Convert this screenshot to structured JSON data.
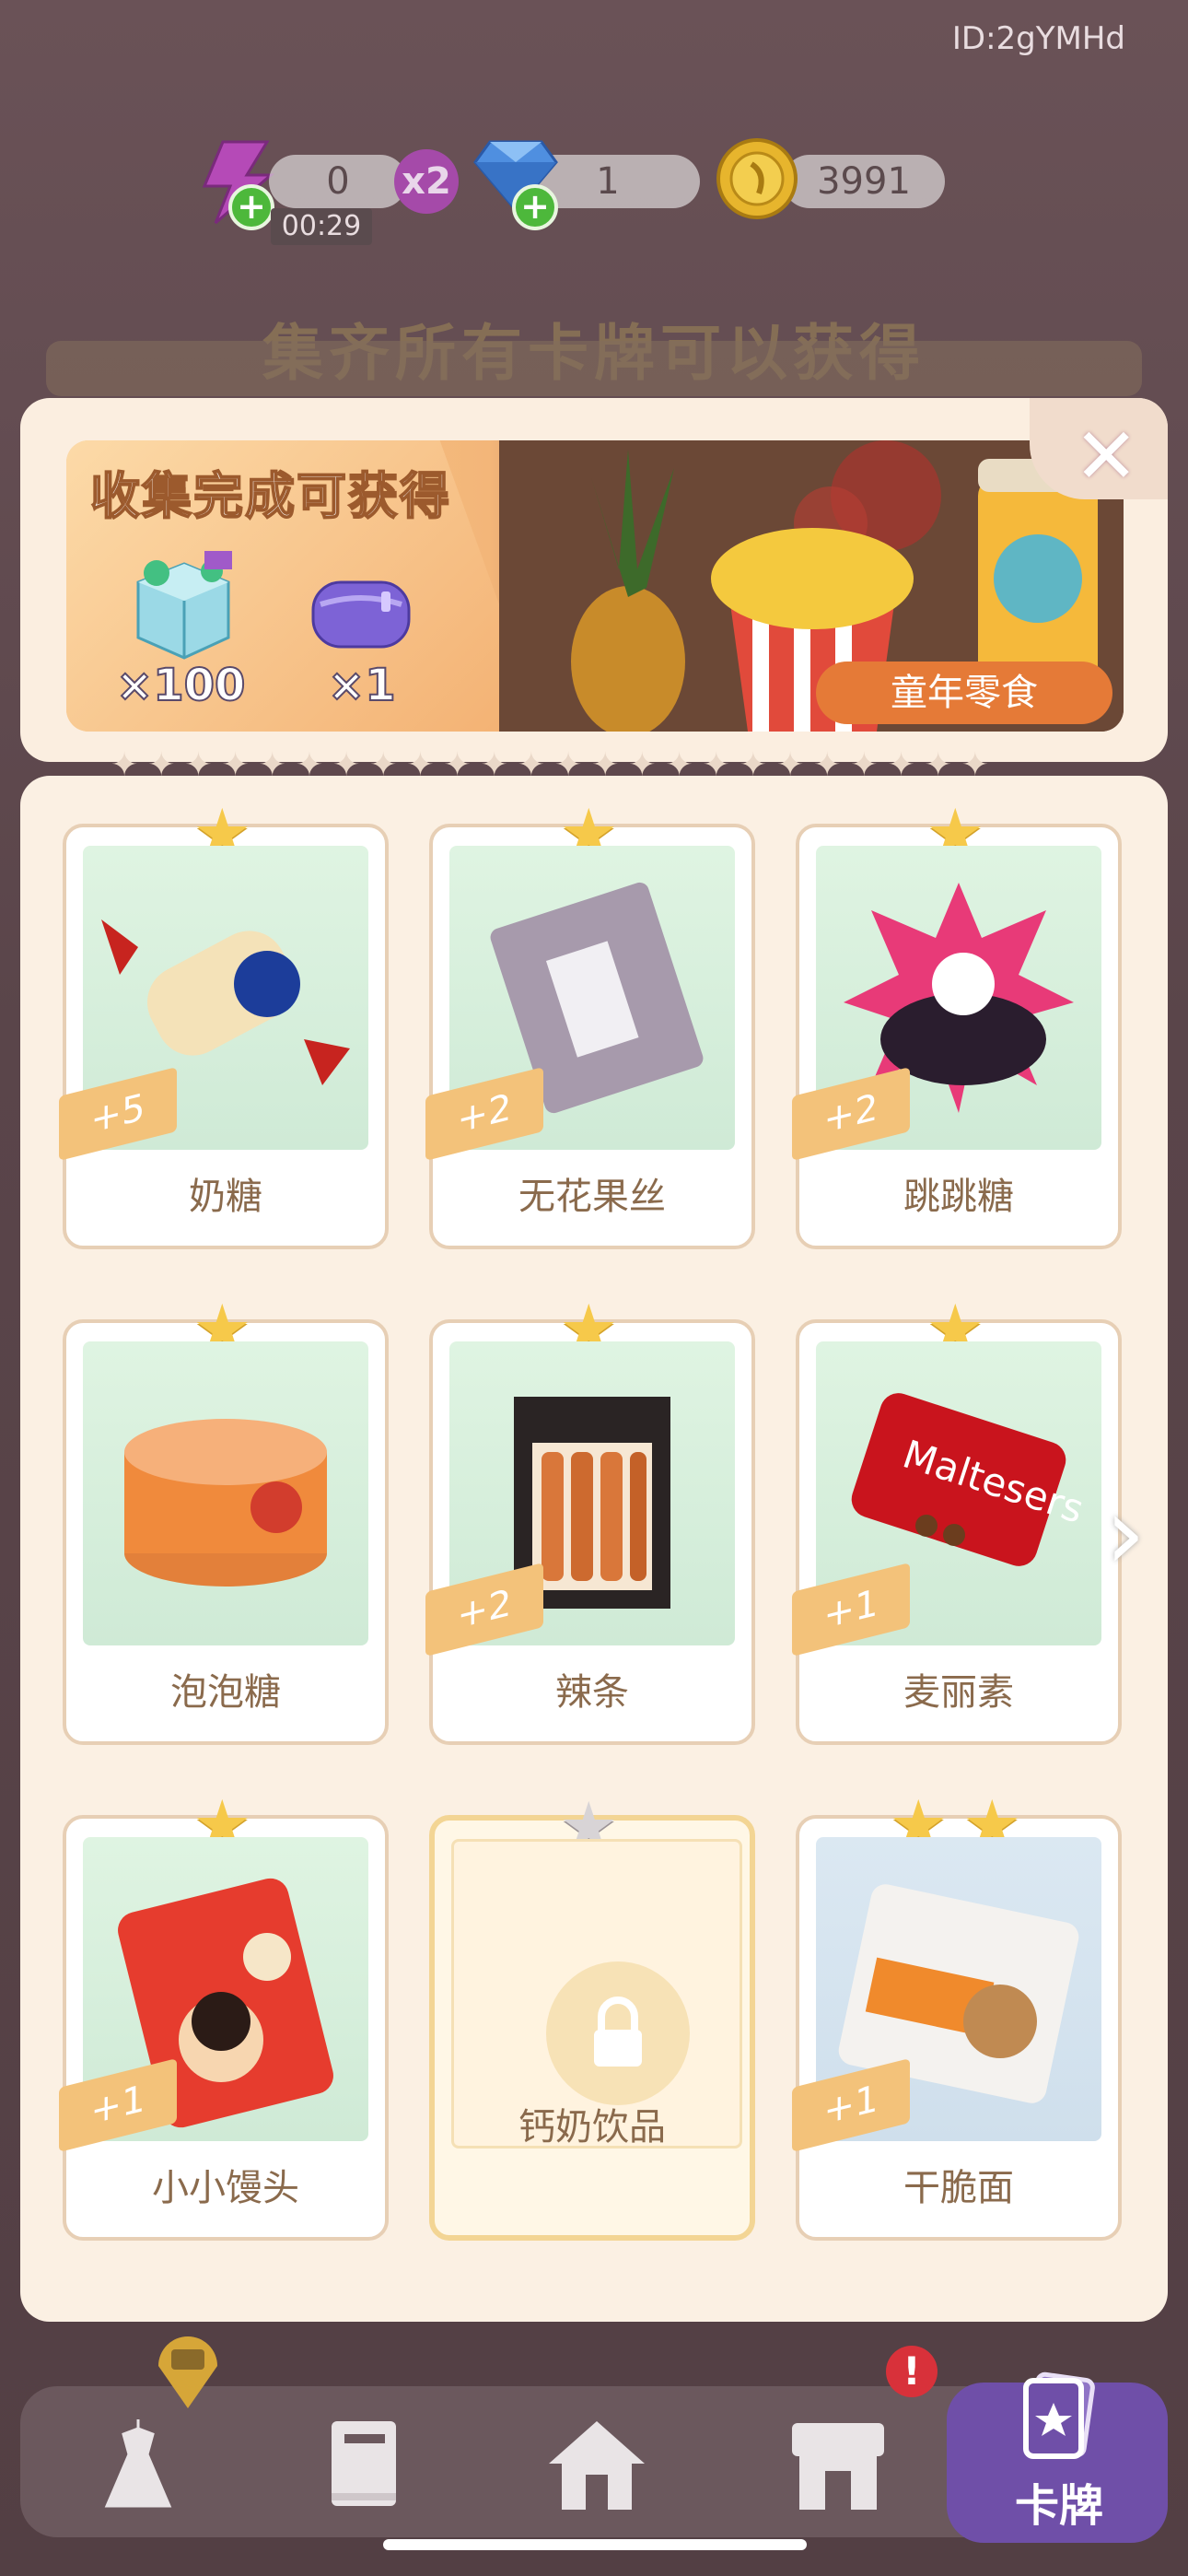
{
  "status": {
    "user_id": "ID:2gYMHd"
  },
  "resources": {
    "energy": {
      "value": "0",
      "multiplier": "x2",
      "timer": "00:29"
    },
    "gems": {
      "value": "1"
    },
    "coins": {
      "value": "3991"
    }
  },
  "background": {
    "title": "集齐所有卡牌可以获得"
  },
  "reward_banner": {
    "title": "收集完成可获得",
    "rewards": [
      {
        "icon": "gem-crate-icon",
        "count": "×100"
      },
      {
        "icon": "purple-pouch-icon",
        "count": "×1"
      }
    ],
    "collection_name": "童年零食"
  },
  "cards": [
    {
      "name": "奶糖",
      "bonus": "+5",
      "stars": 1,
      "locked": false,
      "icon": "milk-candy-icon"
    },
    {
      "name": "无花果丝",
      "bonus": "+2",
      "stars": 1,
      "locked": false,
      "icon": "fig-shreds-icon"
    },
    {
      "name": "跳跳糖",
      "bonus": "+2",
      "stars": 1,
      "locked": false,
      "icon": "popping-candy-icon"
    },
    {
      "name": "泡泡糖",
      "bonus": "",
      "stars": 1,
      "locked": false,
      "icon": "bubble-gum-icon"
    },
    {
      "name": "辣条",
      "bonus": "+2",
      "stars": 1,
      "locked": false,
      "icon": "spicy-strip-icon"
    },
    {
      "name": "麦丽素",
      "bonus": "+1",
      "stars": 1,
      "locked": false,
      "icon": "maltesers-icon",
      "brand_text": "Maltesers"
    },
    {
      "name": "小小馒头",
      "bonus": "+1",
      "stars": 1,
      "locked": false,
      "icon": "baby-buns-icon"
    },
    {
      "name": "钙奶饮品",
      "bonus": "",
      "stars": 1,
      "locked": true,
      "icon": "lock-icon"
    },
    {
      "name": "干脆面",
      "bonus": "+1",
      "stars": 2,
      "locked": false,
      "icon": "crispy-noodles-icon"
    }
  ],
  "nav": {
    "items": [
      {
        "icon": "dress-icon"
      },
      {
        "icon": "book-icon"
      },
      {
        "icon": "home-icon"
      },
      {
        "icon": "shop-icon",
        "badge": "!"
      },
      {
        "icon": "card-icon",
        "label": "卡牌",
        "active": true
      }
    ]
  },
  "colors": {
    "accent_orange": "#e57a37",
    "star": "#f6c94a",
    "nav_active": "#6f4fa8",
    "card_bg": "#dff4e2"
  }
}
